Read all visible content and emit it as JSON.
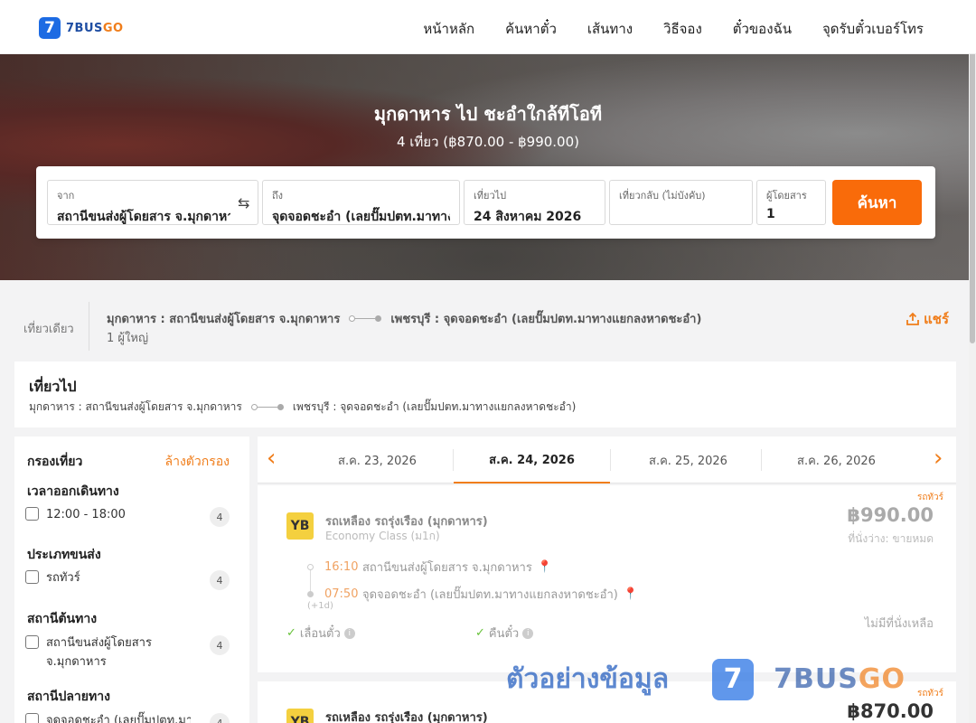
{
  "header": {
    "logo_mark": "7",
    "logo_text_a": "7BUS",
    "logo_text_b": "GO",
    "nav": [
      "หน้าหลัก",
      "ค้นหาตั๋ว",
      "เส้นทาง",
      "วิธีจอง",
      "ตั๋วของฉัน",
      "จุดรับตั๋วเบอร์โทร"
    ]
  },
  "hero": {
    "title": "มุกดาหาร ไป ชะอำใกล้ทีโอที",
    "subtitle": "4 เที่ยว (฿870.00 - ฿990.00)"
  },
  "search": {
    "from_label": "จาก",
    "from_value": "สถานีขนส่งผู้โดยสาร จ.มุกดาหาร",
    "swap_icon": "⇆",
    "to_label": "ถึง",
    "to_value": "จุดจอดชะอำ (เลยปั๊มปตท.มาทางแยกลงหาดชะอำ)",
    "depart_label": "เที่ยวไป",
    "depart_value": "24 สิงหาคม 2026",
    "return_label": "เที่ยวกลับ (ไม่บังคับ)",
    "return_value": "",
    "pax_label": "ผู้โดยสาร",
    "pax_value": "1",
    "button": "ค้นหา"
  },
  "summary": {
    "trip_type": "เที่ยวเดียว",
    "origin": "มุกดาหาร : สถานีขนส่งผู้โดยสาร จ.มุกดาหาร",
    "destination": "เพชรบุรี : จุดจอดชะอำ (เลยปั๊มปตท.มาทางแยกลงหาดชะอำ)",
    "passengers": "1 ผู้ใหญ่",
    "share": "แชร์"
  },
  "outbound": {
    "title": "เที่ยวไป",
    "origin": "มุกดาหาร : สถานีขนส่งผู้โดยสาร จ.มุกดาหาร",
    "destination": "เพชรบุรี : จุดจอดชะอำ (เลยปั๊มปตท.มาทางแยกลงหาดชะอำ)"
  },
  "filters": {
    "title": "กรองเที่ยว",
    "clear": "ล้างตัวกรอง",
    "groups": [
      {
        "title": "เวลาออกเดินทาง",
        "options": [
          {
            "label": "12:00 - 18:00",
            "count": "4"
          }
        ]
      },
      {
        "title": "ประเภทขนส่ง",
        "options": [
          {
            "label": "รถทัวร์",
            "count": "4"
          }
        ]
      },
      {
        "title": "สถานีต้นทาง",
        "options": [
          {
            "label": "สถานีขนส่งผู้โดยสาร จ.มุกดาหาร",
            "count": "4"
          }
        ]
      },
      {
        "title": "สถานีปลายทาง",
        "options": [
          {
            "label": "จุดจอดชะอำ (เลยปั๊มปตท.มา",
            "count": "4"
          }
        ]
      }
    ]
  },
  "dates": {
    "tabs": [
      "ส.ค. 23, 2026",
      "ส.ค. 24, 2026",
      "ส.ค. 25, 2026",
      "ส.ค. 26, 2026"
    ],
    "active_index": 1
  },
  "results": [
    {
      "tag": "รถทัวร์",
      "operator": "รถเหลือง รถรุ่งเรือง (มุกดาหาร)",
      "class": "Economy Class (ม1ก)",
      "price": "฿990.00",
      "seats": "ที่นั่งว่าง: ขายหมด",
      "depart_time": "16:10",
      "depart_station": "สถานีขนส่งผู้โดยสาร จ.มุกดาหาร",
      "arrive_time": "07:50",
      "arrive_station": "จุดจอดชะอำ (เลยปั๊มปตท.มาทางแยกลงหาดชะอำ)",
      "plus_day": "(+1d)",
      "perk1": "เลื่อนตั๋ว",
      "perk2": "คืนตั๋ว",
      "status": "ไม่มีที่นั่งเหลือ"
    },
    {
      "tag": "รถทัวร์",
      "operator": "รถเหลือง รถรุ่งเรือง (มุกดาหาร)",
      "price": "฿870.00"
    }
  ],
  "watermark": {
    "text": "ตัวอย่างข้อมูล",
    "mark": "7",
    "brand_a": "7BUS",
    "brand_b": "GO"
  },
  "colors": {
    "accent": "#f07d1a",
    "search_button": "#f96b0a",
    "brand_blue": "#1d6be3"
  }
}
